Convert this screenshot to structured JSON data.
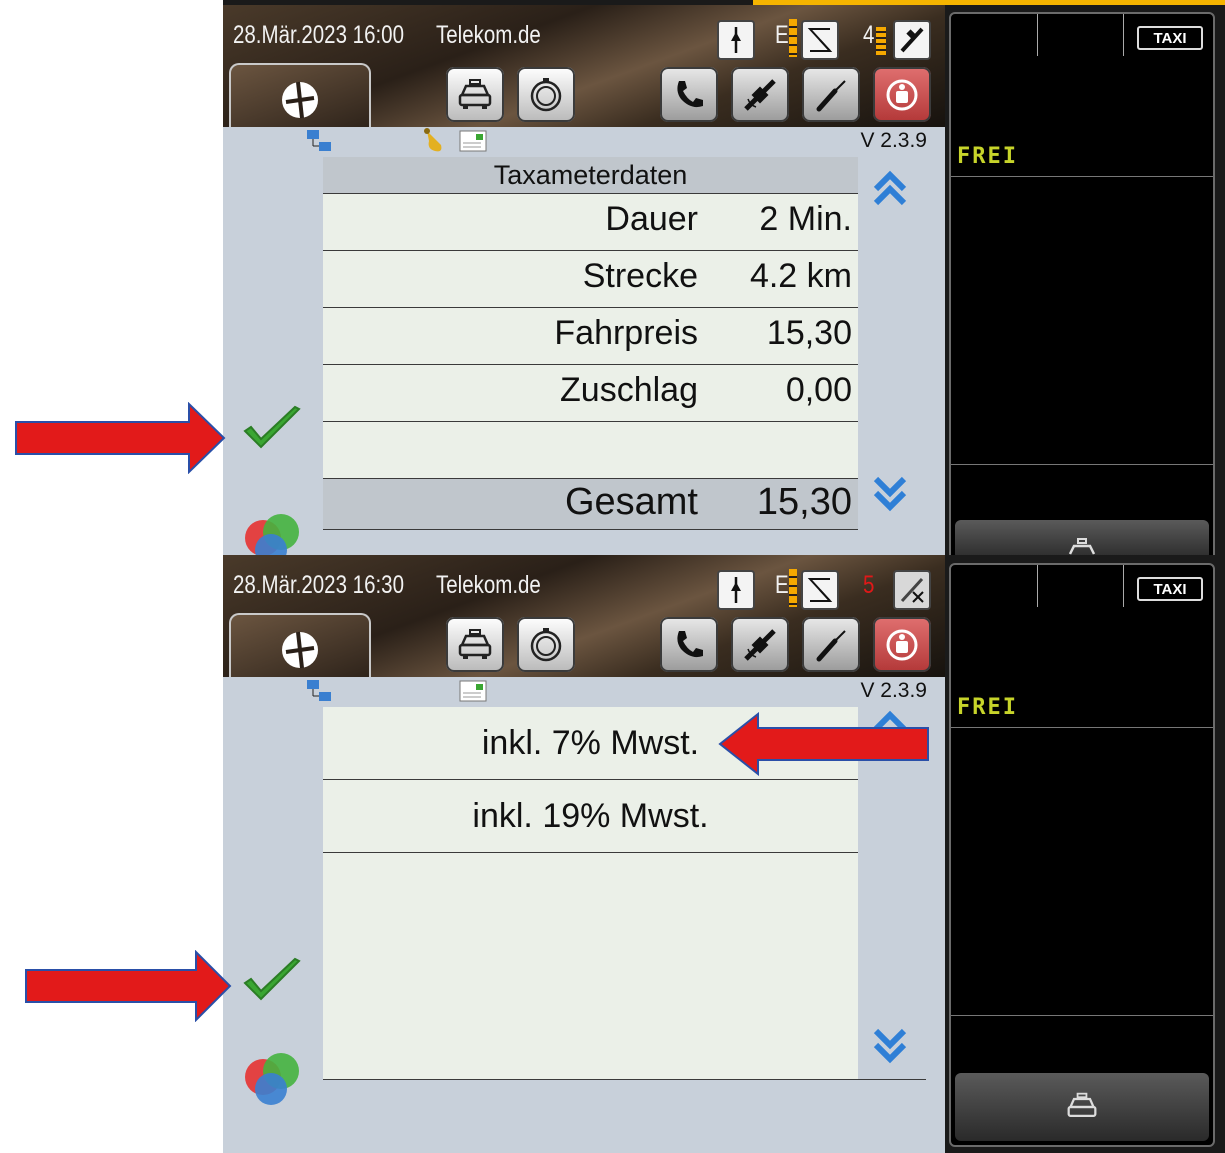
{
  "screen1": {
    "status": {
      "datetime": "28.Mär.2023 16:00",
      "carrier": "Telekom.de",
      "network_letter": "E",
      "satellite_count": "4"
    },
    "version": "V 2.3.9",
    "table": {
      "header": "Taxameterdaten",
      "rows": [
        {
          "label": "Dauer",
          "value": "2 Min."
        },
        {
          "label": "Strecke",
          "value": "4.2 km"
        },
        {
          "label": "Fahrpreis",
          "value": "15,30"
        },
        {
          "label": "Zuschlag",
          "value": "0,00"
        }
      ],
      "total": {
        "label": "Gesamt",
        "value": "15,30"
      }
    },
    "meter": {
      "taxi_sign": "TAXI",
      "status": "FREI"
    }
  },
  "screen2": {
    "status": {
      "datetime": "28.Mär.2023 16:30",
      "carrier": "Telekom.de",
      "network_letter": "E",
      "satellite_count": "5"
    },
    "version": "V 2.3.9",
    "options": [
      "inkl. 7% Mwst.",
      "inkl. 19% Mwst."
    ],
    "meter": {
      "taxi_sign": "TAXI",
      "status": "FREI"
    }
  },
  "colors": {
    "check": "#3aa632",
    "arrow": "#e21a1a",
    "frei": "#c7d42a",
    "chevron": "#2f7fd6",
    "content_bg": "#c8d0da"
  },
  "icons": [
    "home-icon",
    "taxi-icon",
    "timer-icon",
    "phone-icon",
    "satellite-icon",
    "tools-icon",
    "emergency-icon",
    "network-icon",
    "bell-icon",
    "message-icon",
    "check-icon",
    "color-circles-icon",
    "chevron-up-icon",
    "chevron-down-icon"
  ]
}
